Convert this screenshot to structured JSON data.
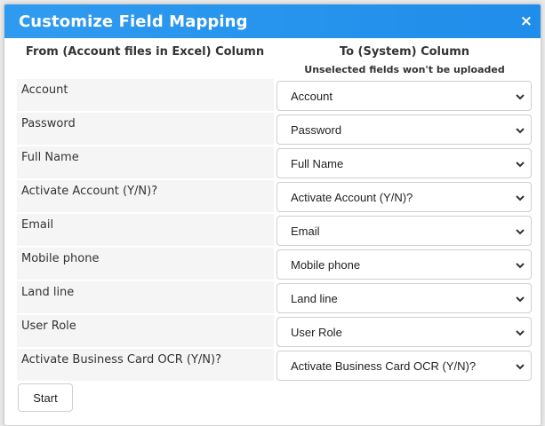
{
  "dialog": {
    "title": "Customize Field Mapping",
    "close_label": "×"
  },
  "columns": {
    "from_header": "From (Account files in Excel) Column",
    "to_header": "To (System) Column",
    "to_note": "Unselected fields won't be uploaded"
  },
  "mappings": [
    {
      "source": "Account",
      "target": "Account"
    },
    {
      "source": "Password",
      "target": "Password"
    },
    {
      "source": "Full Name",
      "target": "Full Name"
    },
    {
      "source": "Activate Account (Y/N)?",
      "target": "Activate Account (Y/N)?"
    },
    {
      "source": "Email",
      "target": "Email"
    },
    {
      "source": "Mobile phone",
      "target": "Mobile phone"
    },
    {
      "source": "Land line",
      "target": "Land line"
    },
    {
      "source": "User Role",
      "target": "User Role"
    },
    {
      "source": "Activate Business Card OCR (Y/N)?",
      "target": "Activate Business Card OCR (Y/N)?"
    }
  ],
  "actions": {
    "start_label": "Start"
  },
  "icons": {
    "close": "close-icon",
    "dropdown": "chevron-down-icon"
  },
  "colors": {
    "header_bg": "#2196f3",
    "header_text": "#ffffff",
    "row_label_bg": "#f5f5f5"
  }
}
